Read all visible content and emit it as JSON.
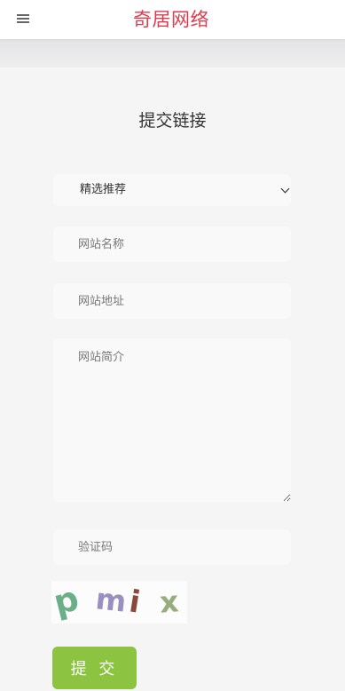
{
  "header": {
    "logo_text": "奇居网络",
    "menu_icon": "hamburger-menu-icon",
    "logo_color": "#e03a4e"
  },
  "form": {
    "title": "提交链接",
    "category_select": {
      "selected": "精选推荐"
    },
    "site_name": {
      "placeholder": "网站名称"
    },
    "site_url": {
      "placeholder": "网站地址"
    },
    "site_description": {
      "placeholder": "网站简介"
    },
    "captcha_field": {
      "placeholder": "验证码"
    },
    "captcha_image": {
      "chars": [
        "p",
        "m",
        "i",
        "x"
      ]
    },
    "submit_label": "提 交",
    "submit_color": "#8cc340"
  }
}
